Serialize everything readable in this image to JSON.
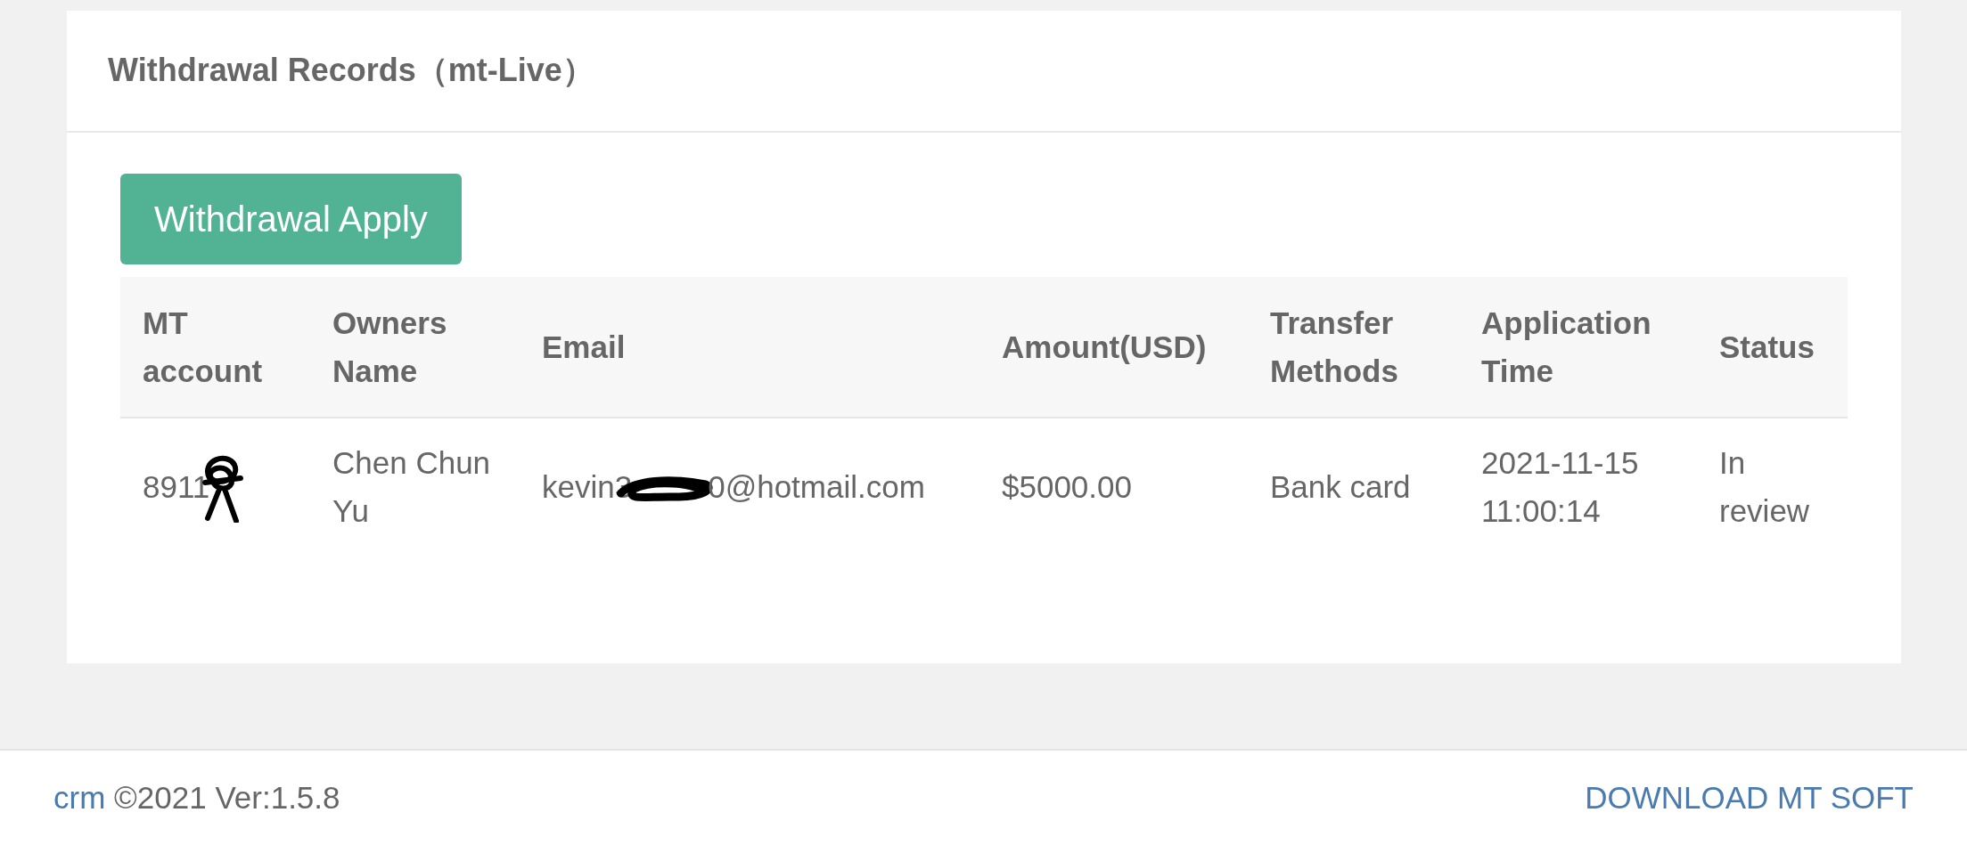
{
  "panel": {
    "title": "Withdrawal Records（mt-Live）"
  },
  "apply_button": {
    "label": "Withdrawal Apply"
  },
  "table": {
    "columns": [
      "MT account",
      "Owners Name",
      "Email",
      "Amount(USD)",
      "Transfer Methods",
      "Application Time",
      "Status"
    ],
    "rows": [
      {
        "account": "8911",
        "owner": "Chen Chun Yu",
        "email_start": "kevin3",
        "email_end": "0@hotmail.com",
        "amount": "$5000.00",
        "method": "Bank card",
        "time": "2021-11-15 11:00:14",
        "status": "In review"
      }
    ]
  },
  "footer": {
    "brand": "crm",
    "version": "©2021 Ver:1.5.8",
    "download_link": "DOWNLOAD MT SOFT"
  }
}
